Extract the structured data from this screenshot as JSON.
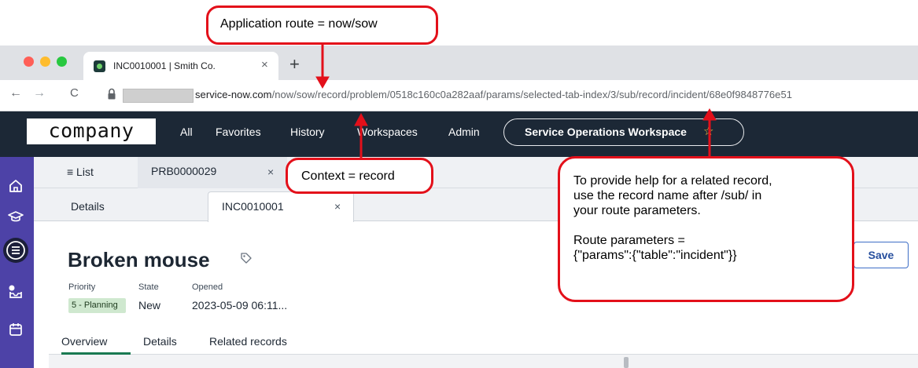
{
  "callouts": {
    "route": "Application route = now/sow",
    "context": "Context = record",
    "help": {
      "line1": "To provide help for a related record,",
      "line2": "use the record name after /sub/ in",
      "line3": "your route parameters.",
      "line4": "Route parameters =",
      "line5": "{\"params\":{\"table\":\"incident\"}}"
    }
  },
  "browser": {
    "tab_title": "INC0010001 | Smith Co.",
    "tab_close": "×",
    "new_tab": "+",
    "nav": {
      "back": "←",
      "forward": "→",
      "reload": "C"
    },
    "url_domain": "service-now.com",
    "url_path": "/now/sow/record/problem/0518c160c0a282aaf/params/selected-tab-index/3/sub/record/incident/68e0f9848776e51"
  },
  "app_header": {
    "logo": "COMPANY",
    "nav": [
      "All",
      "Favorites",
      "History",
      "Workspaces",
      "Admin"
    ],
    "workspace_pill": "Service Operations Workspace",
    "star_icon": "star-outline-icon"
  },
  "workspace_tabs": {
    "list_label": "≡ List",
    "record_tab": "PRB0000029",
    "record_tab_close": "×"
  },
  "sub_tabs": {
    "details": "Details",
    "incident": "INC0010001",
    "incident_close": "×"
  },
  "record": {
    "title": "Broken mouse",
    "priority_label": "Priority",
    "priority_value": "5 - Planning",
    "state_label": "State",
    "state_value": "New",
    "opened_label": "Opened",
    "opened_value": "2023-05-09 06:11...",
    "save": "Save"
  },
  "detail_tabs": [
    "Overview",
    "Details",
    "Related records"
  ],
  "colors": {
    "callout_border": "#e3101a",
    "app_header": "#1c2836",
    "rail": "#4d42a7",
    "priority_badge": "#cfe8cf",
    "active_underline": "#1a7a52"
  }
}
